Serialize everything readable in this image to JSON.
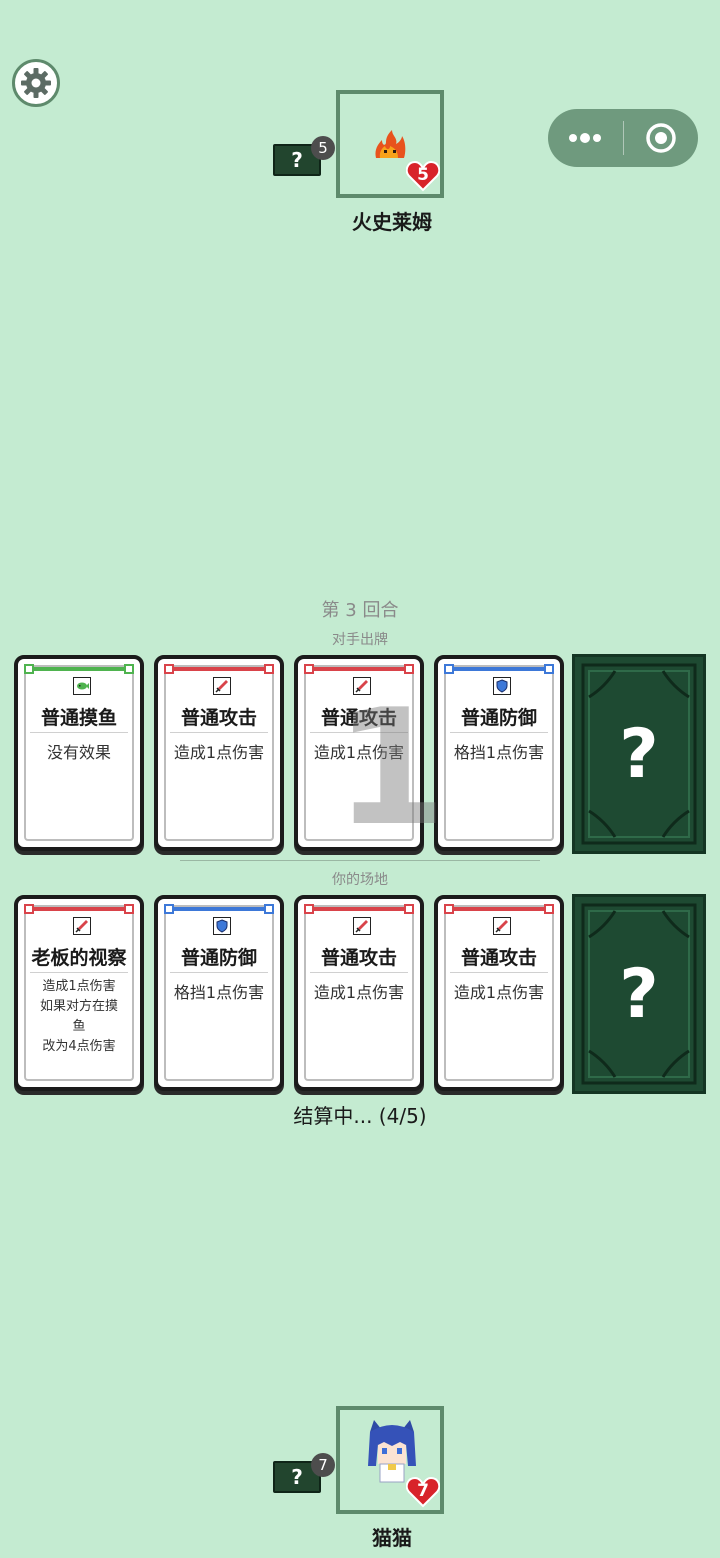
{
  "settings": {
    "icon": "gear-icon"
  },
  "capsule": {
    "menu_icon": "more-dots-icon",
    "close_icon": "target-circle-icon"
  },
  "opponent": {
    "name": "火史莱姆",
    "hp": "5",
    "deck_count": "5",
    "deck_label": "?",
    "avatar": "fire-slime-icon"
  },
  "player": {
    "name": "猫猫",
    "hp": "7",
    "deck_count": "7",
    "deck_label": "?",
    "avatar": "cat-girl-avatar"
  },
  "round": {
    "label": "第 3 回合",
    "opponent_label": "对手出牌",
    "your_label": "你的场地"
  },
  "countdown": "1",
  "status": "结算中... (4/5)",
  "opponent_cards": [
    {
      "title": "普通摸鱼",
      "desc": "没有效果",
      "icon": "fish-icon",
      "color": "#4fb34f"
    },
    {
      "title": "普通攻击",
      "desc": "造成1点伤害",
      "icon": "sword-icon",
      "color": "#d9434a"
    },
    {
      "title": "普通攻击",
      "desc": "造成1点伤害",
      "icon": "sword-icon",
      "color": "#d9434a"
    },
    {
      "title": "普通防御",
      "desc": "格挡1点伤害",
      "icon": "shield-icon",
      "color": "#3d78d8"
    }
  ],
  "player_cards": [
    {
      "title": "老板的视察",
      "desc": "造成1点伤害\n如果对方在摸\n鱼\n改为4点伤害",
      "icon": "sword-icon",
      "color": "#d9434a"
    },
    {
      "title": "普通防御",
      "desc": "格挡1点伤害",
      "icon": "shield-icon",
      "color": "#3d78d8"
    },
    {
      "title": "普通攻击",
      "desc": "造成1点伤害",
      "icon": "sword-icon",
      "color": "#d9434a"
    },
    {
      "title": "普通攻击",
      "desc": "造成1点伤害",
      "icon": "sword-icon",
      "color": "#d9434a"
    }
  ],
  "card_back": {
    "label": "?"
  }
}
